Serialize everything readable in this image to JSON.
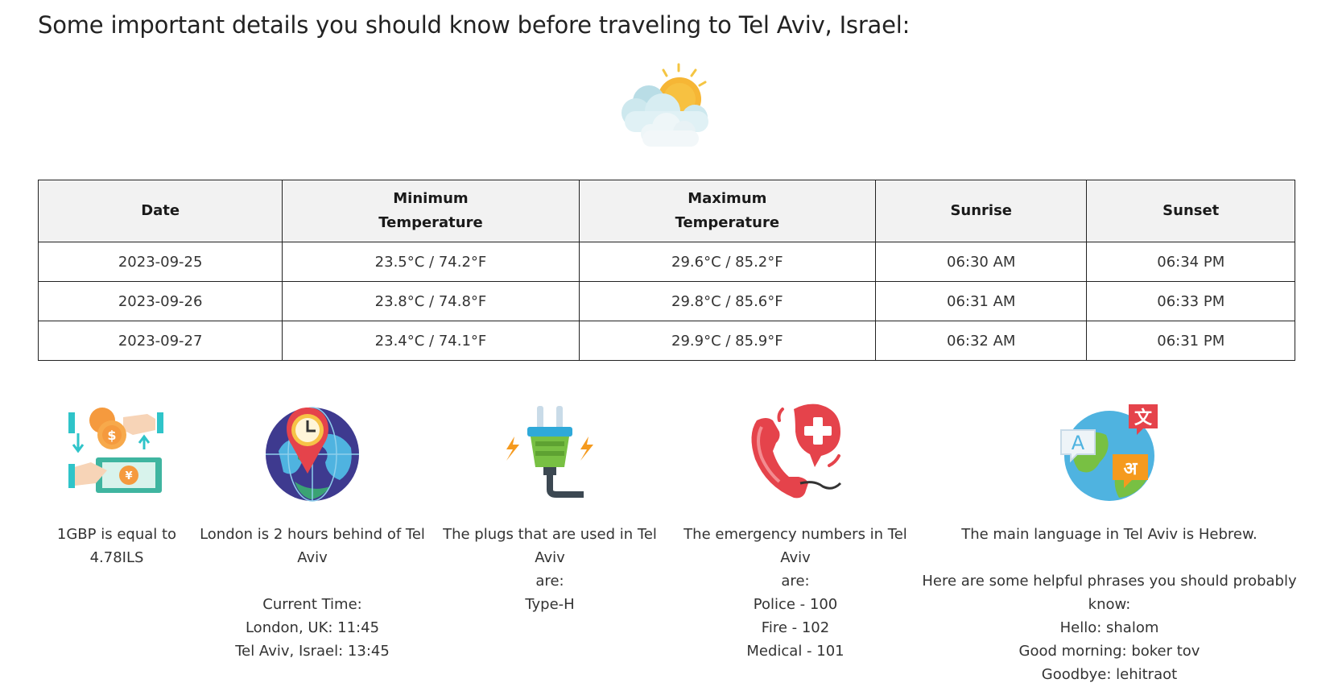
{
  "heading": "Some important details you should know before traveling to Tel Aviv, Israel:",
  "weather_icon": "sun-behind-clouds-icon",
  "table": {
    "headers": {
      "date": "Date",
      "min_line1": "Minimum",
      "min_line2": "Temperature",
      "max_line1": "Maximum",
      "max_line2": "Temperature",
      "sunrise": "Sunrise",
      "sunset": "Sunset"
    },
    "rows": [
      {
        "date": "2023-09-25",
        "min": "23.5°C / 74.2°F",
        "max": "29.6°C / 85.2°F",
        "sunrise": "06:30 AM",
        "sunset": "06:34 PM"
      },
      {
        "date": "2023-09-26",
        "min": "23.8°C / 74.8°F",
        "max": "29.8°C / 85.6°F",
        "sunrise": "06:31 AM",
        "sunset": "06:33 PM"
      },
      {
        "date": "2023-09-27",
        "min": "23.4°C / 74.1°F",
        "max": "29.9°C / 85.9°F",
        "sunrise": "06:32 AM",
        "sunset": "06:31 PM"
      }
    ]
  },
  "currency": {
    "icon": "currency-exchange-icon",
    "line1": "1GBP is equal to",
    "line2": "4.78ILS"
  },
  "time": {
    "icon": "timezone-globe-icon",
    "line1": "London is 2 hours behind of Tel",
    "line2": "Aviv",
    "current_label": "Current Time:",
    "london": "London, UK: 11:45",
    "telaviv": "Tel Aviv, Israel: 13:45"
  },
  "plugs": {
    "icon": "power-plug-icon",
    "line1": "The plugs that are used in Tel Aviv",
    "line2": "are:",
    "type": "Type-H"
  },
  "emergency": {
    "icon": "emergency-phone-icon",
    "line1": "The emergency numbers in Tel Aviv",
    "line2": "are:",
    "police": "Police - 100",
    "fire": "Fire - 102",
    "medical": "Medical - 101"
  },
  "language": {
    "icon": "language-translation-icon",
    "line1": "The main language in Tel Aviv is Hebrew.",
    "phrases_line1": "Here are some helpful phrases you should probably",
    "phrases_line2": "know:",
    "hello": "Hello: shalom",
    "good_morning": "Good morning: boker tov",
    "goodbye": "Goodbye: lehitraot"
  }
}
